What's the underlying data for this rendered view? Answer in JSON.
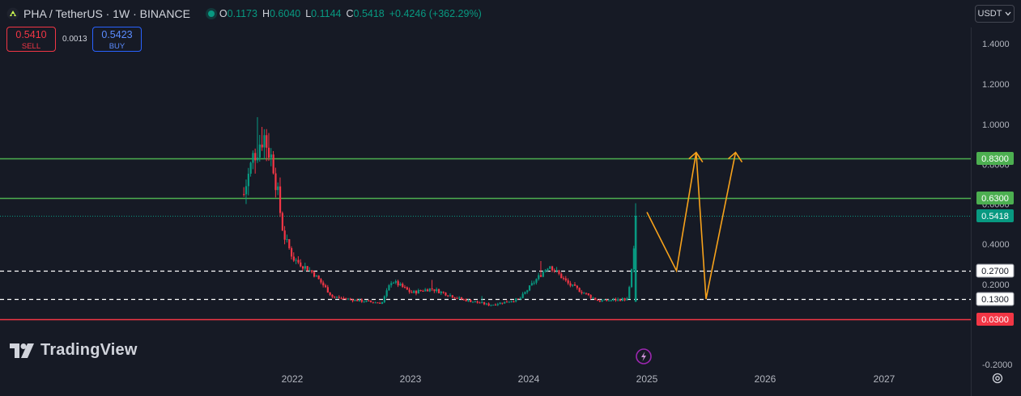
{
  "header": {
    "symbol_title": "PHA / TetherUS · 1W · BINANCE",
    "ohlc": {
      "o_label": "O",
      "o_value": "0.1173",
      "h_label": "H",
      "h_value": "0.6040",
      "l_label": "L",
      "l_value": "0.1144",
      "c_label": "C",
      "c_value": "0.5418",
      "change": "+0.4246 (+362.29%)"
    }
  },
  "trade": {
    "sell_price": "0.5410",
    "sell_label": "SELL",
    "spread": "0.0013",
    "buy_price": "0.5423",
    "buy_label": "BUY"
  },
  "currency": {
    "label": "USDT",
    "icon": "chevron-down-icon"
  },
  "watermark": {
    "text": "TradingView",
    "icon": "tradingview-logo-icon"
  },
  "colors": {
    "background": "#161a25",
    "up": "#089981",
    "down": "#f23645",
    "level_green": "#4caf50",
    "level_red": "#f23645",
    "projection": "#f7a21b",
    "current_price": "#089981"
  },
  "chart_data": {
    "type": "candlestick",
    "timeframe": "1W",
    "y_axis": {
      "ticks": [
        "1.4000",
        "1.2000",
        "1.0000",
        "0.8000",
        "0.6000",
        "0.4000",
        "0.2000",
        "-0.2000"
      ],
      "range": [
        -0.2,
        1.4
      ],
      "scale": "custom non-linear (as shown)"
    },
    "x_axis": {
      "ticks": [
        "2022",
        "2023",
        "2024",
        "2025",
        "2026",
        "2027"
      ]
    },
    "price_levels": [
      {
        "value": 0.83,
        "label": "0.8300",
        "style": "solid",
        "color": "#4caf50"
      },
      {
        "value": 0.63,
        "label": "0.6300",
        "style": "solid",
        "color": "#4caf50"
      },
      {
        "value": 0.27,
        "label": "0.2700",
        "style": "dashed",
        "color": "#ffffff"
      },
      {
        "value": 0.13,
        "label": "0.1300",
        "style": "dashed",
        "color": "#ffffff"
      },
      {
        "value": 0.03,
        "label": "0.0300",
        "style": "solid",
        "color": "#f23645"
      }
    ],
    "current_price": {
      "value": 0.5418,
      "label": "0.5418"
    },
    "price_path": [
      {
        "date": "2021-08",
        "price": 0.65
      },
      {
        "date": "2021-09",
        "price": 0.85
      },
      {
        "date": "2021-10",
        "price": 0.95
      },
      {
        "date": "2021-11",
        "price": 0.8
      },
      {
        "date": "2021-12",
        "price": 0.45
      },
      {
        "date": "2022-01",
        "price": 0.33
      },
      {
        "date": "2022-03",
        "price": 0.26
      },
      {
        "date": "2022-05",
        "price": 0.14
      },
      {
        "date": "2022-08",
        "price": 0.12
      },
      {
        "date": "2022-10",
        "price": 0.11
      },
      {
        "date": "2022-11",
        "price": 0.22
      },
      {
        "date": "2023-01",
        "price": 0.16
      },
      {
        "date": "2023-03",
        "price": 0.18
      },
      {
        "date": "2023-06",
        "price": 0.13
      },
      {
        "date": "2023-09",
        "price": 0.1
      },
      {
        "date": "2023-12",
        "price": 0.13
      },
      {
        "date": "2024-03",
        "price": 0.3
      },
      {
        "date": "2024-05",
        "price": 0.2
      },
      {
        "date": "2024-08",
        "price": 0.12
      },
      {
        "date": "2024-11",
        "price": 0.13
      },
      {
        "date": "2024-12",
        "price": 0.5418
      }
    ],
    "projection": [
      {
        "date": "2025-01",
        "price": 0.56
      },
      {
        "date": "2025-04",
        "price": 0.27
      },
      {
        "date": "2025-06",
        "price": 0.86
      },
      {
        "date": "2025-07",
        "price": 0.13
      },
      {
        "date": "2025-10",
        "price": 0.86
      }
    ],
    "marker": {
      "date": "2025-01",
      "icon": "lightning-icon"
    }
  }
}
